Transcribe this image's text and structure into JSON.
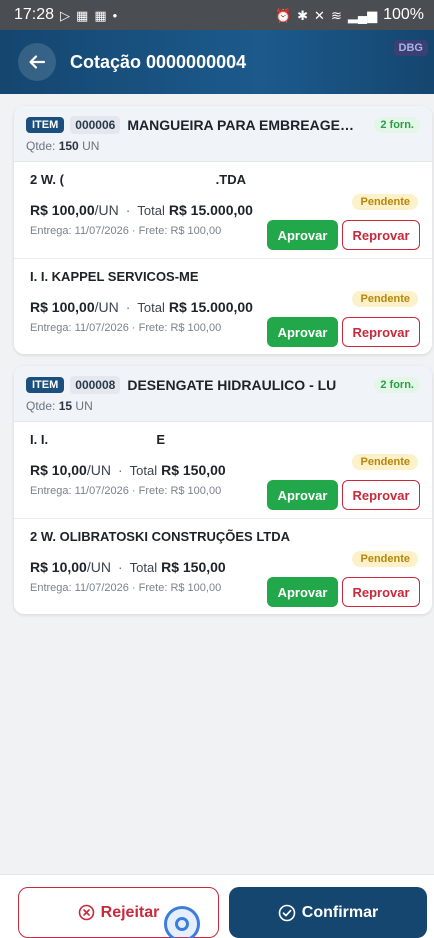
{
  "status_bar": {
    "time": "17:28",
    "battery": "100%"
  },
  "header": {
    "title": "Cotação 0000000004",
    "debug_badge": "DBG"
  },
  "items": [
    {
      "tag": "ITEM",
      "code": "000006",
      "name": "MANGUEIRA PARA EMBREAGEM ...",
      "suppliers_count": "2 forn.",
      "qty_label": "Qtde:",
      "qty_value": "150",
      "qty_unit": "UN",
      "suppliers": [
        {
          "name": "2 W. (                                          .TDA",
          "status": "Pendente",
          "price": "R$ 100,00",
          "unit": "/UN",
          "total_label": "Total",
          "total": "R$ 15.000,00",
          "meta": "Entrega: 11/07/2026 · Frete: R$ 100,00",
          "approve_label": "Aprovar",
          "reject_label": "Reprovar"
        },
        {
          "name": "I. I. KAPPEL SERVICOS-ME",
          "status": "Pendente",
          "price": "R$ 100,00",
          "unit": "/UN",
          "total_label": "Total",
          "total": "R$ 15.000,00",
          "meta": "Entrega: 11/07/2026 · Frete: R$ 100,00",
          "approve_label": "Aprovar",
          "reject_label": "Reprovar"
        }
      ]
    },
    {
      "tag": "ITEM",
      "code": "000008",
      "name": "DESENGATE HIDRAULICO - LU",
      "suppliers_count": "2 forn.",
      "qty_label": "Qtde:",
      "qty_value": "15",
      "qty_unit": "UN",
      "suppliers": [
        {
          "name": "I. I.                              E",
          "status": "Pendente",
          "price": "R$ 10,00",
          "unit": "/UN",
          "total_label": "Total",
          "total": "R$ 150,00",
          "meta": "Entrega: 11/07/2026 · Frete: R$ 100,00",
          "approve_label": "Aprovar",
          "reject_label": "Reprovar"
        },
        {
          "name": "2 W. OLIBRATOSKI CONSTRUÇÕES LTDA",
          "status": "Pendente",
          "price": "R$ 10,00",
          "unit": "/UN",
          "total_label": "Total",
          "total": "R$ 150,00",
          "meta": "Entrega: 11/07/2026 · Frete: R$ 100,00",
          "approve_label": "Aprovar",
          "reject_label": "Reprovar"
        }
      ]
    }
  ],
  "footer": {
    "reject_label": "Rejeitar",
    "confirm_label": "Confirmar"
  },
  "icons": {
    "back": "arrow-left-icon",
    "reject": "circle-x-icon",
    "confirm": "circle-check-icon"
  },
  "colors": {
    "primary": "#14466f",
    "approve": "#22a84a",
    "reject": "#c62a3b",
    "pending_bg": "#fdf1c9",
    "pending_text": "#b8860b"
  }
}
